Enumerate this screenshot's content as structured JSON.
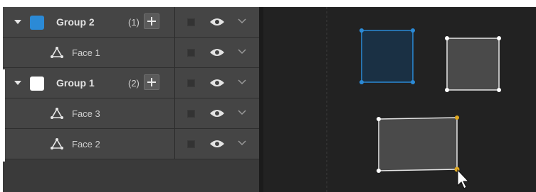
{
  "layers": [
    {
      "type": "group",
      "name": "Group 2",
      "count": "(1)",
      "color": "#2b8ad6",
      "expanded": true
    },
    {
      "type": "face",
      "name": "Face 1"
    },
    {
      "type": "group",
      "name": "Group 1",
      "count": "(2)",
      "color": "#ffffff",
      "expanded": true,
      "active": true
    },
    {
      "type": "face",
      "name": "Face 3"
    },
    {
      "type": "face",
      "name": "Face 2"
    }
  ],
  "icons": {
    "expand": "caret-down-icon",
    "add": "plus-icon",
    "face": "triangle-mesh-icon",
    "visibility": "eye-icon",
    "menu": "chevron-down-icon",
    "cursor": "mouse-pointer-icon"
  },
  "viewport": {
    "selected_shape_color": "#2b8ad6",
    "shape_fill": "#4a4a4a",
    "handle_highlight_color": "#e0a820"
  }
}
